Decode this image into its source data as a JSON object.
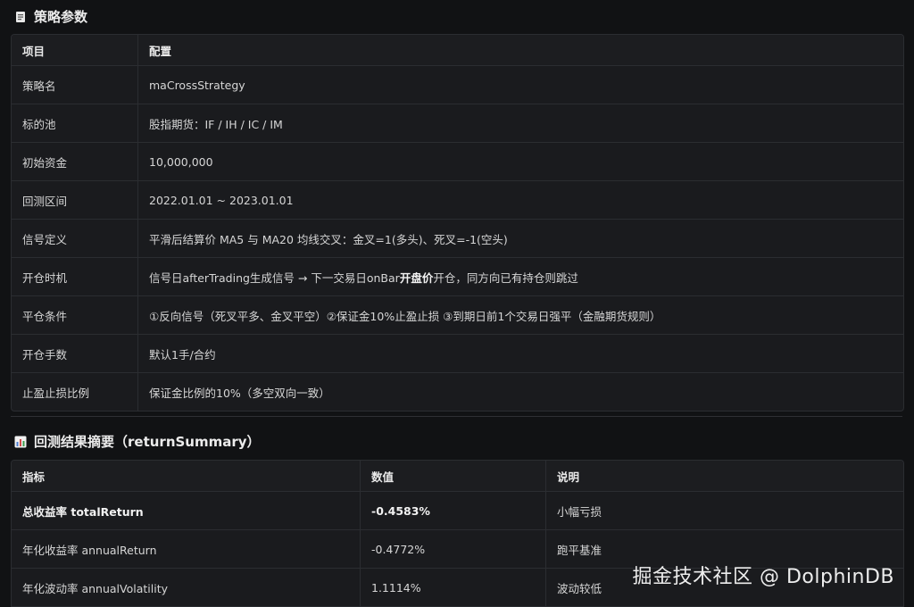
{
  "section1": {
    "title": "策略参数",
    "icon": "memo-icon",
    "headers": [
      "项目",
      "配置"
    ],
    "rows": [
      {
        "k": "策略名",
        "v": "maCrossStrategy"
      },
      {
        "k": "标的池",
        "v": "股指期货：IF / IH / IC / IM"
      },
      {
        "k": "初始资金",
        "v": "10,000,000"
      },
      {
        "k": "回测区间",
        "v": "2022.01.01 ~ 2023.01.01"
      },
      {
        "k": "信号定义",
        "v": "平滑后结算价 MA5 与 MA20 均线交叉：金叉=1(多头)、死叉=-1(空头)"
      },
      {
        "k": "开仓时机",
        "v_pre": "信号日afterTrading生成信号 → 下一交易日onBar",
        "v_bold": "开盘价",
        "v_post": "开仓，同方向已有持仓则跳过"
      },
      {
        "k": "平仓条件",
        "v": "①反向信号（死叉平多、金叉平空）②保证金10%止盈止损 ③到期日前1个交易日强平（金融期货规则）"
      },
      {
        "k": "开仓手数",
        "v": "默认1手/合约"
      },
      {
        "k": "止盈止损比例",
        "v": "保证金比例的10%（多空双向一致）"
      }
    ]
  },
  "section2": {
    "title": "回测结果摘要（returnSummary）",
    "icon": "bar-chart-icon",
    "headers": [
      "指标",
      "数值",
      "说明"
    ],
    "rows": [
      {
        "metric": "总收益率 totalReturn",
        "value": "-0.4583%",
        "note": "小幅亏损"
      },
      {
        "metric": "年化收益率 annualReturn",
        "value": "-0.4772%",
        "note": "跑平基准"
      },
      {
        "metric": "年化波动率 annualVolatility",
        "value": "1.1114%",
        "note": "波动较低"
      }
    ]
  },
  "watermark": "掘金技术社区 @ DolphinDB",
  "colors": {
    "background": "#111214",
    "table": "#1a1b1e",
    "border": "#2b2d31",
    "text": "#d6d6d6"
  }
}
